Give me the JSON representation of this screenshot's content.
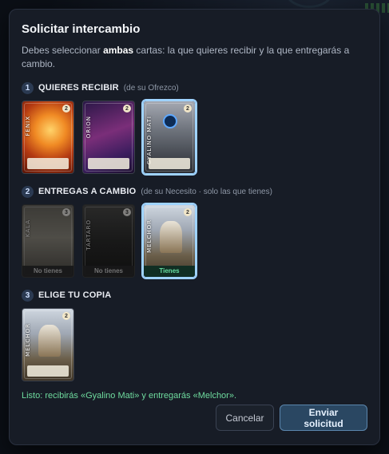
{
  "modal": {
    "title": "Solicitar intercambio",
    "intro_prefix": "Debes seleccionar ",
    "intro_bold": "ambas",
    "intro_suffix": " cartas: la que quieres recibir y la que entregarás a cambio."
  },
  "steps": [
    {
      "number": "1",
      "title": "QUIERES RECIBIR",
      "subtitle": "(de su Ofrezco)",
      "cards": [
        {
          "name": "FENIX",
          "cost": "2",
          "selected": false,
          "dim": false,
          "badge": ""
        },
        {
          "name": "ORION",
          "cost": "2",
          "selected": false,
          "dim": false,
          "badge": ""
        },
        {
          "name": "GYALINO MATI",
          "cost": "2",
          "selected": true,
          "dim": false,
          "badge": ""
        }
      ]
    },
    {
      "number": "2",
      "title": "ENTREGAS A CAMBIO",
      "subtitle": "(de su Necesito · solo las que tienes)",
      "cards": [
        {
          "name": "KALA",
          "cost": "3",
          "selected": false,
          "dim": true,
          "badge": "No tienes"
        },
        {
          "name": "TARTARO",
          "cost": "3",
          "selected": false,
          "dim": true,
          "badge": "No tienes"
        },
        {
          "name": "MELCHOR",
          "cost": "2",
          "selected": true,
          "dim": false,
          "badge": "Tienes"
        }
      ]
    },
    {
      "number": "3",
      "title": "ELIGE TU COPIA",
      "subtitle": "",
      "cards": [
        {
          "name": "MELCHOR",
          "cost": "2",
          "selected": false,
          "dim": false,
          "badge": ""
        }
      ]
    }
  ],
  "status": "Listo: recibirás «Gyalino Mati» y entregarás «Melchor».",
  "buttons": {
    "cancel": "Cancelar",
    "send": "Enviar solicitud"
  }
}
